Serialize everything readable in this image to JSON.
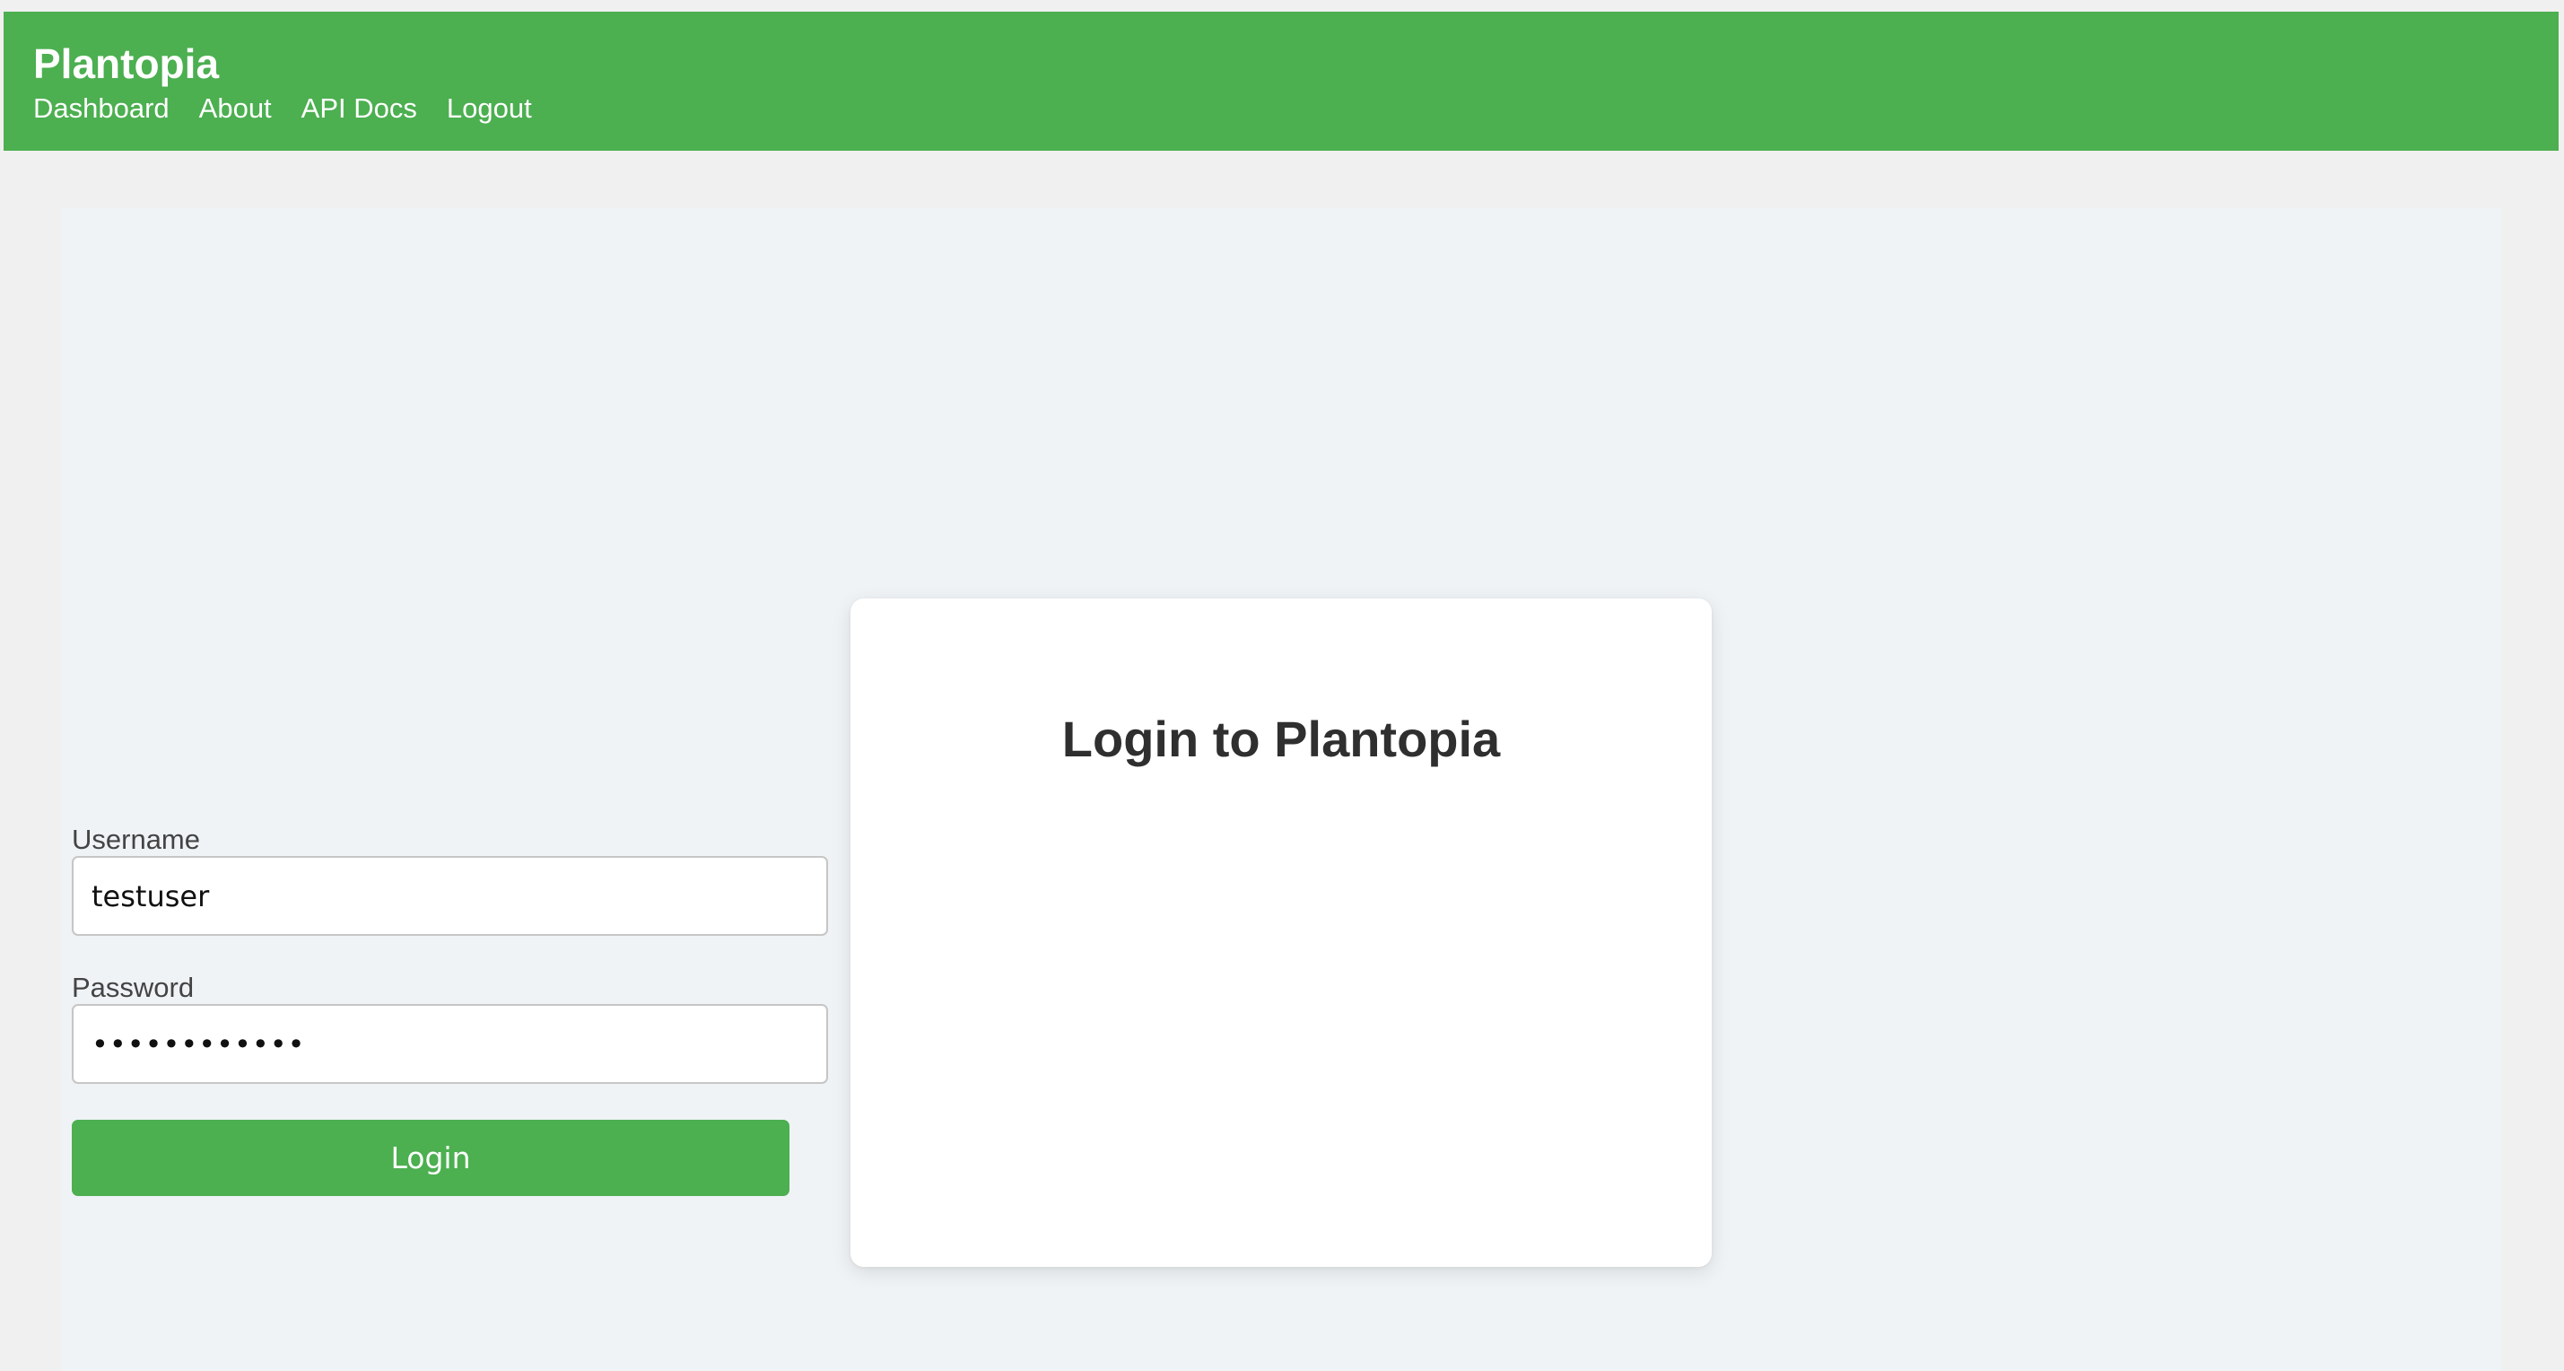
{
  "app": {
    "brand": "Plantopia"
  },
  "nav": {
    "links": [
      {
        "label": "Dashboard"
      },
      {
        "label": "About"
      },
      {
        "label": "API Docs"
      },
      {
        "label": "Logout"
      }
    ]
  },
  "login": {
    "title": "Login to Plantopia",
    "username_label": "Username",
    "username_value": "testuser",
    "password_label": "Password",
    "password_value": "testpassword",
    "submit_label": "Login"
  },
  "colors": {
    "brand_green": "#4caf50",
    "page_background": "#f0f0f0",
    "content_background": "#eff3f6",
    "card_background": "#ffffff"
  }
}
